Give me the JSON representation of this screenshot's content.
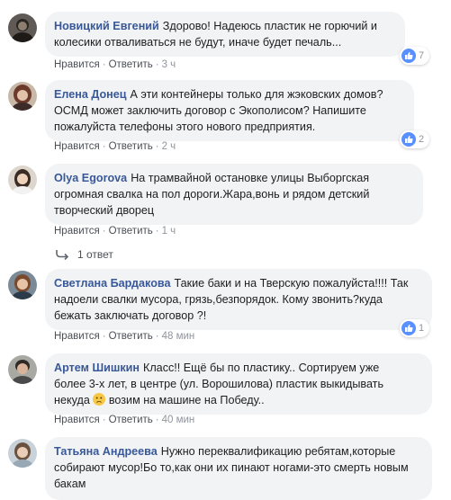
{
  "comments": [
    {
      "author": "Новицкий Евгений",
      "text_lines": [
        "Здорово! Надеюсь пластик не горючий и",
        "колесики отваливаться не будут, иначе будет печаль..."
      ],
      "like_label": "Нравится",
      "reply_label": "Ответить",
      "time": "3 ч",
      "reactions": "7"
    },
    {
      "author": "Елена Донец",
      "text_lines": [
        "А эти контейнеры только для жэковских домов?",
        "ОСМД может заключить договор с Экополисом? Напишите",
        "пожалуйста телефоны этого нового предприятия."
      ],
      "like_label": "Нравится",
      "reply_label": "Ответить",
      "time": "2 ч",
      "reactions": "2"
    },
    {
      "author": "Olya Egorova",
      "text_lines": [
        "На трамвайной остановке улицы Выборгская",
        "огромная свалка на пол дороги.Жара,вонь и рядом детский",
        "творческий дворец"
      ],
      "like_label": "Нравится",
      "reply_label": "Ответить",
      "time": "1 ч",
      "replies": "1 ответ"
    },
    {
      "author": "Светлана Бардакова",
      "text_lines": [
        "Такие баки и на Тверскую пожалуйста!!!! Так",
        "надоели свалки мусора, грязь,безпорядок. Кому звонить?куда",
        "бежать заключать договор ?!"
      ],
      "like_label": "Нравится",
      "reply_label": "Ответить",
      "time": "48 мин",
      "reactions": "1"
    },
    {
      "author": "Артем Шишкин",
      "text_lines": [
        "Класс!! Ещё бы по пластику.. Сортируем уже",
        "более 3-х лет, в центре (ул. Ворошилова) пластик выкидывать",
        "некуда",
        "возим на машине на Победу.."
      ],
      "like_label": "Нравится",
      "reply_label": "Ответить",
      "time": "40 мин"
    },
    {
      "author": "Татьяна Андреева",
      "text_lines": [
        "Нужно переквалификацию ребятам,которые",
        "собирают мусор!Бо то,как они их пинают ногами-это смерть новым",
        "бакам"
      ]
    }
  ],
  "colors": {
    "author": "#385898",
    "bubble": "#f2f3f5",
    "like": "#5890ff",
    "meta": "#90949c"
  }
}
